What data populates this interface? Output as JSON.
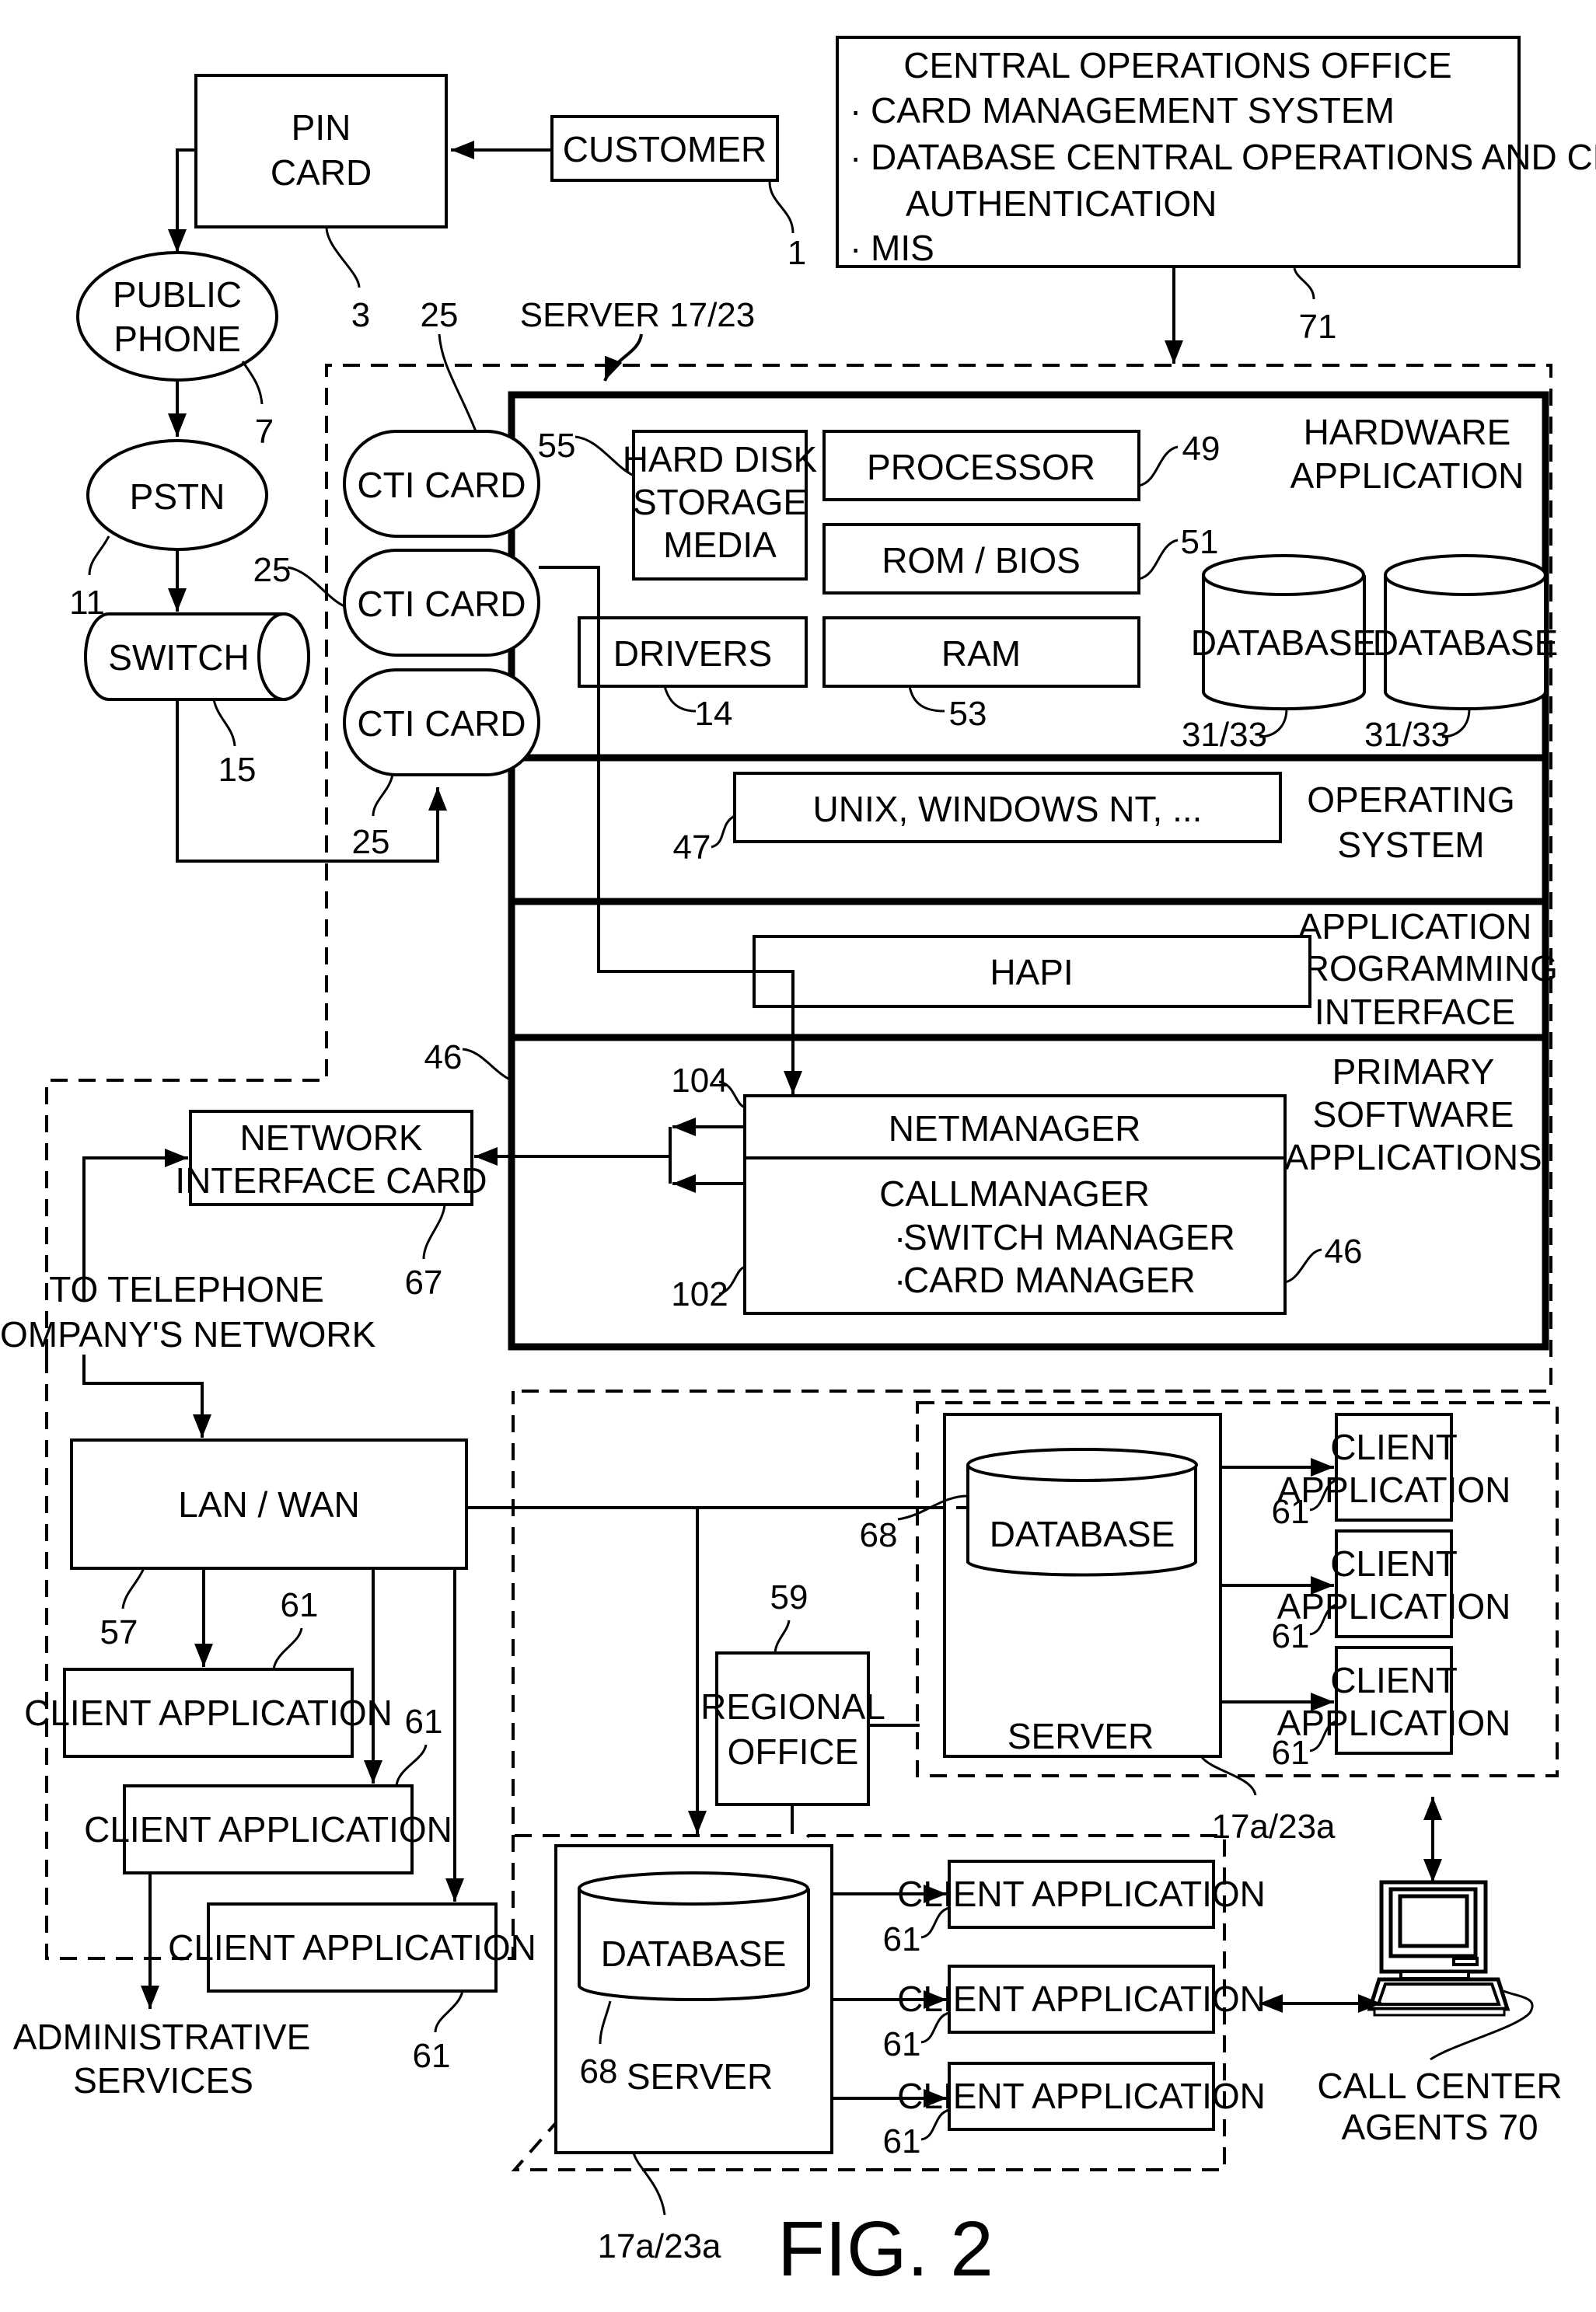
{
  "figure": {
    "title": "FIG. 2"
  },
  "nodes": {
    "customer": {
      "label": "CUSTOMER",
      "ref": "1"
    },
    "pin_card": {
      "lines": [
        "PIN",
        "CARD"
      ],
      "ref": "3"
    },
    "public_phone": {
      "lines": [
        "PUBLIC",
        "PHONE"
      ],
      "ref": "7"
    },
    "pstn": {
      "label": "PSTN",
      "ref": "11"
    },
    "switch": {
      "label": "SWITCH",
      "ref": "15"
    },
    "cti_cards": [
      {
        "label": "CTI CARD",
        "ref": "25"
      },
      {
        "label": "CTI CARD",
        "ref": "25"
      },
      {
        "label": "CTI CARD",
        "ref": "25"
      }
    ],
    "central_office": {
      "title": "CENTRAL OPERATIONS OFFICE",
      "items": [
        "CARD MANAGEMENT SYSTEM",
        "DATABASE CENTRAL OPERATIONS AND CENTRAL",
        "AUTHENTICATION",
        "MIS"
      ],
      "bullet": "·",
      "ref": "71"
    },
    "server": {
      "label": "SERVER 17/23",
      "layers": {
        "hardware": {
          "title": [
            "HARDWARE",
            "APPLICATION"
          ],
          "hard_disk": {
            "lines": [
              "HARD DISK",
              "STORAGE",
              "MEDIA"
            ],
            "ref": "55"
          },
          "processor": {
            "label": "PROCESSOR",
            "ref": "49"
          },
          "rom_bios": {
            "label": "ROM / BIOS",
            "ref": "51"
          },
          "drivers": {
            "label": "DRIVERS",
            "ref": "14"
          },
          "ram": {
            "label": "RAM",
            "ref": "53"
          },
          "databases": [
            {
              "label": "DATABASE",
              "ref": "31/33"
            },
            {
              "label": "DATABASE",
              "ref": "31/33"
            }
          ]
        },
        "os": {
          "title": [
            "OPERATING",
            "SYSTEM"
          ],
          "box": {
            "label": "UNIX, WINDOWS NT, ...",
            "ref": "47"
          }
        },
        "api": {
          "title": [
            "APPLICATION",
            "PROGRAMMING",
            "INTERFACE"
          ],
          "box": {
            "label": "HAPI"
          }
        },
        "software": {
          "title": [
            "PRIMARY",
            "SOFTWARE",
            "APPLICATIONS"
          ],
          "ref_left": "46",
          "ref_right": "46",
          "netmanager": {
            "label": "NETMANAGER",
            "ref": "104"
          },
          "callmanager": {
            "title": "CALLMANAGER",
            "items": [
              "SWITCH MANAGER",
              "CARD MANAGER"
            ],
            "ref": "102"
          }
        }
      }
    },
    "nic": {
      "lines": [
        "NETWORK",
        "INTERFACE CARD"
      ],
      "ref": "67"
    },
    "telco_note": {
      "lines": [
        "TO TELEPHONE",
        "COMPANY'S NETWORK"
      ]
    },
    "lan_wan": {
      "label": "LAN / WAN",
      "ref": "57"
    },
    "local_clients": [
      {
        "label": "CLIENT APPLICATION",
        "ref": "61"
      },
      {
        "label": "CLIENT APPLICATION",
        "ref": "61"
      },
      {
        "label": "CLIENT APPLICATION",
        "ref": "61"
      }
    ],
    "admin_services": {
      "lines": [
        "ADMINISTRATIVE",
        "SERVICES"
      ]
    },
    "regional_office": {
      "lines": [
        "REGIONAL",
        "OFFICE"
      ],
      "ref": "59"
    },
    "regional_server_a": {
      "database": "DATABASE",
      "db_ref": "68",
      "server": "SERVER",
      "ref": "17a/23a",
      "clients": [
        {
          "lines": [
            "CLIENT",
            "APPLICATION"
          ],
          "ref": "61"
        },
        {
          "lines": [
            "CLIENT",
            "APPLICATION"
          ],
          "ref": "61"
        },
        {
          "lines": [
            "CLIENT",
            "APPLICATION"
          ],
          "ref": "61"
        }
      ]
    },
    "regional_server_b": {
      "database": "DATABASE",
      "db_ref": "68",
      "server": "SERVER",
      "ref": "17a/23a",
      "clients": [
        {
          "label": "CLIENT APPLICATION",
          "ref": "61"
        },
        {
          "label": "CLIENT APPLICATION",
          "ref": "61"
        },
        {
          "label": "CLIENT APPLICATION",
          "ref": "61"
        }
      ]
    },
    "call_center": {
      "lines": [
        "CALL CENTER",
        "AGENTS 70"
      ]
    }
  }
}
